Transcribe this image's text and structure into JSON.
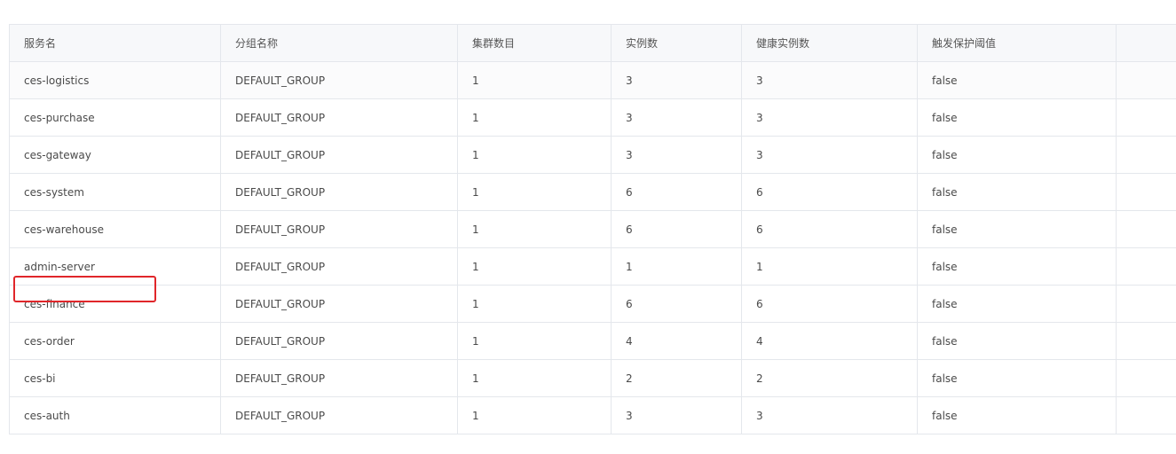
{
  "table": {
    "headers": [
      "服务名",
      "分组名称",
      "集群数目",
      "实例数",
      "健康实例数",
      "触发保护阈值",
      ""
    ],
    "rows": [
      [
        "ces-logistics",
        "DEFAULT_GROUP",
        "1",
        "3",
        "3",
        "false"
      ],
      [
        "ces-purchase",
        "DEFAULT_GROUP",
        "1",
        "3",
        "3",
        "false"
      ],
      [
        "ces-gateway",
        "DEFAULT_GROUP",
        "1",
        "3",
        "3",
        "false"
      ],
      [
        "ces-system",
        "DEFAULT_GROUP",
        "1",
        "6",
        "6",
        "false"
      ],
      [
        "ces-warehouse",
        "DEFAULT_GROUP",
        "1",
        "6",
        "6",
        "false"
      ],
      [
        "admin-server",
        "DEFAULT_GROUP",
        "1",
        "1",
        "1",
        "false"
      ],
      [
        "ces-finance",
        "DEFAULT_GROUP",
        "1",
        "6",
        "6",
        "false"
      ],
      [
        "ces-order",
        "DEFAULT_GROUP",
        "1",
        "4",
        "4",
        "false"
      ],
      [
        "ces-bi",
        "DEFAULT_GROUP",
        "1",
        "2",
        "2",
        "false"
      ],
      [
        "ces-auth",
        "DEFAULT_GROUP",
        "1",
        "3",
        "3",
        "false"
      ]
    ]
  },
  "highlight": {
    "color": "#e0262a",
    "row_index": 5,
    "target": "admin-server"
  }
}
